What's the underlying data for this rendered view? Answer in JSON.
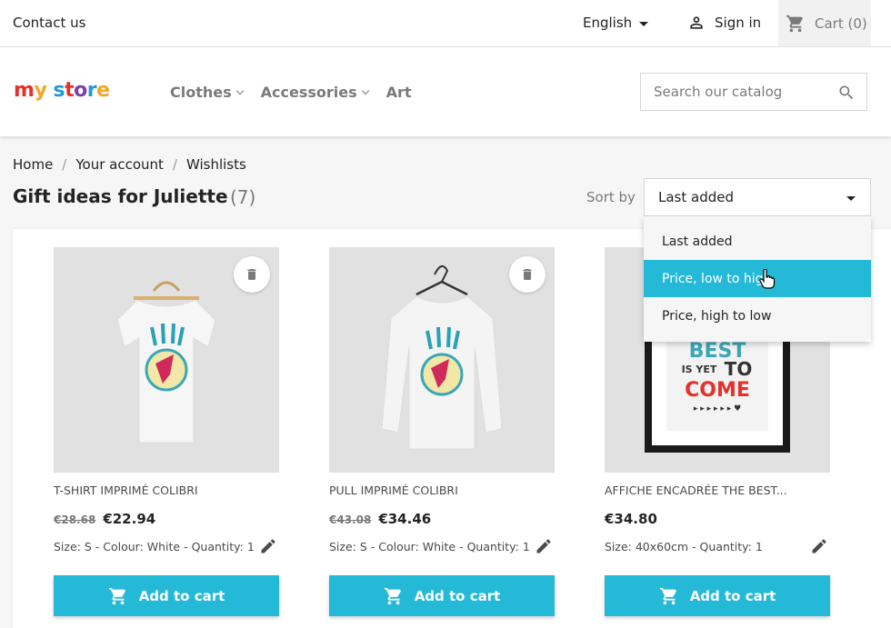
{
  "topbar": {
    "contact": "Contact us",
    "language": "English",
    "signin": "Sign in",
    "cart": "Cart (0)"
  },
  "header": {
    "logo": "my store",
    "nav": [
      "Clothes",
      "Accessories",
      "Art"
    ],
    "search_placeholder": "Search our catalog"
  },
  "breadcrumb": [
    "Home",
    "Your account",
    "Wishlists"
  ],
  "wishlist": {
    "title": "Gift ideas for Juliette",
    "count": "(7)"
  },
  "sort": {
    "label": "Sort by",
    "selected": "Last added",
    "options": [
      "Last added",
      "Price, low to high",
      "Price, high to low"
    ],
    "hovered_index": 1
  },
  "products": [
    {
      "name": "T-SHIRT IMPRIMÉ COLIBRI",
      "old_price": "€28.68",
      "price": "€22.94",
      "attributes": "Size: S - Colour: White - Quantity: 1",
      "add_label": "Add to cart"
    },
    {
      "name": "PULL IMPRIMÉ COLIBRI",
      "old_price": "€43.08",
      "price": "€34.46",
      "attributes": "Size: S - Colour: White - Quantity: 1",
      "add_label": "Add to cart"
    },
    {
      "name": "AFFICHE ENCADRÉE THE BEST...",
      "old_price": "",
      "price": "€34.80",
      "attributes": "Size: 40x60cm - Quantity: 1",
      "add_label": "Add to cart",
      "poster_text": [
        "BEST",
        "IS YET",
        "TO",
        "COME"
      ]
    }
  ],
  "colors": {
    "accent": "#24b9d7",
    "text": "#232323",
    "muted": "#7a7a7a"
  }
}
